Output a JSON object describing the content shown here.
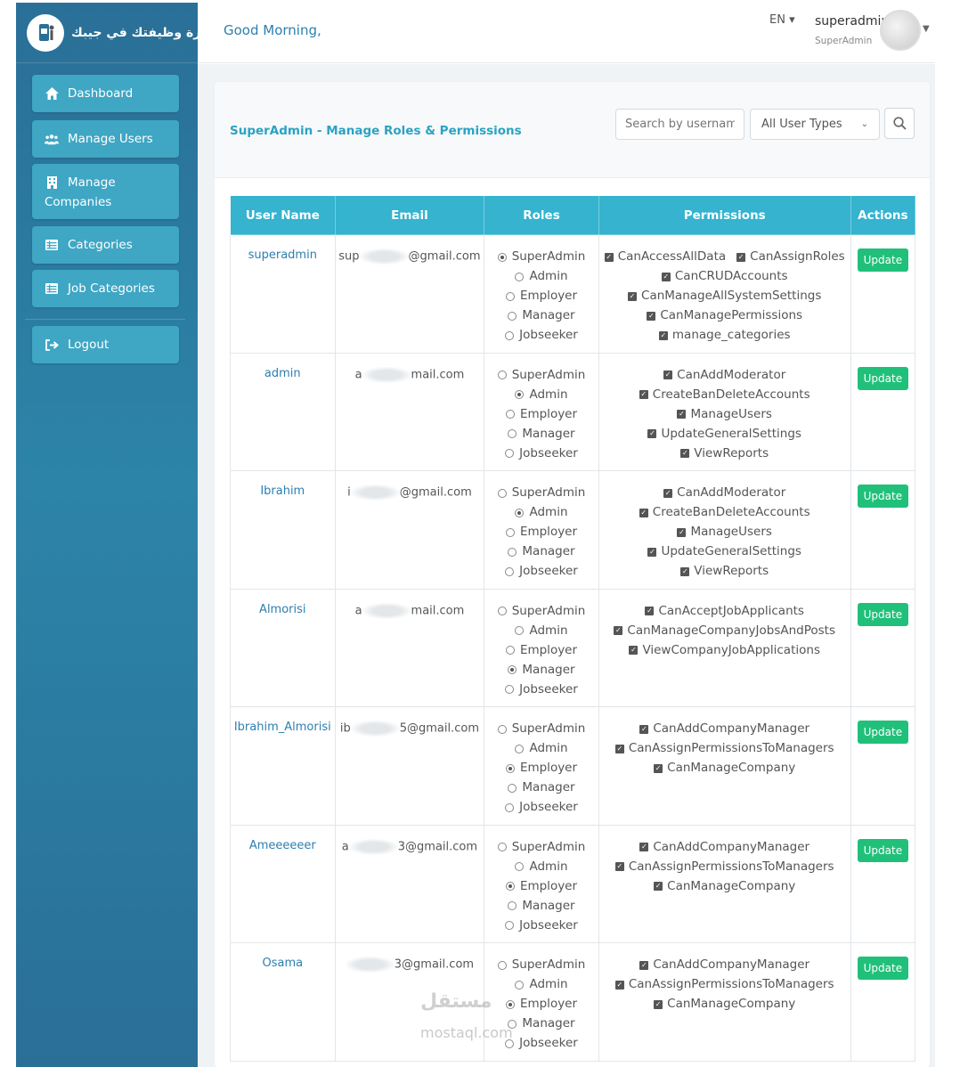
{
  "brand": {
    "title": "إدارة وظيفتك في جيبك"
  },
  "sidebar": {
    "items": [
      {
        "label": "Dashboard",
        "icon": "home-icon"
      },
      {
        "label": "Manage Users",
        "icon": "users-icon"
      },
      {
        "label": "Manage Companies",
        "icon": "building-icon"
      },
      {
        "label": "Categories",
        "icon": "list-icon"
      },
      {
        "label": "Job Categories",
        "icon": "list-icon"
      }
    ],
    "logout": {
      "label": "Logout",
      "icon": "sign-out-icon"
    }
  },
  "topbar": {
    "greeting": "Good Morning,",
    "language": "EN",
    "user_name": "superadmin",
    "user_role": "SuperAdmin"
  },
  "card": {
    "title": "SuperAdmin - Manage Roles & Permissions",
    "search_placeholder": "Search by username,",
    "filter_value": "All User Types"
  },
  "table": {
    "headers": [
      "User Name",
      "Email",
      "Roles",
      "Permissions",
      "Actions"
    ],
    "role_options": [
      "SuperAdmin",
      "Admin",
      "Employer",
      "Manager",
      "Jobseeker"
    ],
    "update_label": "Update",
    "rows": [
      {
        "username": "superadmin",
        "email_start": "sup",
        "email_end": "@gmail.com",
        "role": "SuperAdmin",
        "perm_lines": [
          [
            "CanAccessAllData",
            "CanAssignRoles"
          ],
          [
            "CanCRUDAccounts"
          ],
          [
            "CanManageAllSystemSettings"
          ],
          [
            "CanManagePermissions"
          ],
          [
            "manage_categories"
          ]
        ]
      },
      {
        "username": "admin",
        "email_start": "a",
        "email_end": "mail.com",
        "role": "Admin",
        "perm_lines": [
          [
            "CanAddModerator"
          ],
          [
            "CreateBanDeleteAccounts"
          ],
          [
            "ManageUsers"
          ],
          [
            "UpdateGeneralSettings"
          ],
          [
            "ViewReports"
          ]
        ]
      },
      {
        "username": "Ibrahim",
        "email_start": "i",
        "email_end": "@gmail.com",
        "role": "Admin",
        "perm_lines": [
          [
            "CanAddModerator"
          ],
          [
            "CreateBanDeleteAccounts"
          ],
          [
            "ManageUsers"
          ],
          [
            "UpdateGeneralSettings"
          ],
          [
            "ViewReports"
          ]
        ]
      },
      {
        "username": "Almorisi",
        "email_start": "a",
        "email_end": "mail.com",
        "role": "Manager",
        "perm_lines": [
          [
            "CanAcceptJobApplicants"
          ],
          [
            "CanManageCompanyJobsAndPosts"
          ],
          [
            "ViewCompanyJobApplications"
          ]
        ]
      },
      {
        "username": "Ibrahim_Almorisi",
        "email_start": "ib",
        "email_end": "5@gmail.com",
        "role": "Employer",
        "perm_lines": [
          [
            "CanAddCompanyManager"
          ],
          [
            "CanAssignPermissionsToManagers"
          ],
          [
            "CanManageCompany"
          ]
        ]
      },
      {
        "username": "Ameeeeeer",
        "email_start": "a",
        "email_end": "3@gmail.com",
        "role": "Employer",
        "perm_lines": [
          [
            "CanAddCompanyManager"
          ],
          [
            "CanAssignPermissionsToManagers"
          ],
          [
            "CanManageCompany"
          ]
        ]
      },
      {
        "username": "Osama",
        "email_start": "",
        "email_end": "3@gmail.com",
        "role": "Employer",
        "perm_lines": [
          [
            "CanAddCompanyManager"
          ],
          [
            "CanAssignPermissionsToManagers"
          ],
          [
            "CanManageCompany"
          ]
        ]
      }
    ]
  },
  "watermark": {
    "arabic": "مستقل",
    "latin": "mostaql.com"
  },
  "colors": {
    "sidebar": "#2a6f97",
    "nav_item": "#3fa6c4",
    "header": "#35b3cf",
    "update_button": "#21c07a",
    "title": "#2aa3c2"
  }
}
